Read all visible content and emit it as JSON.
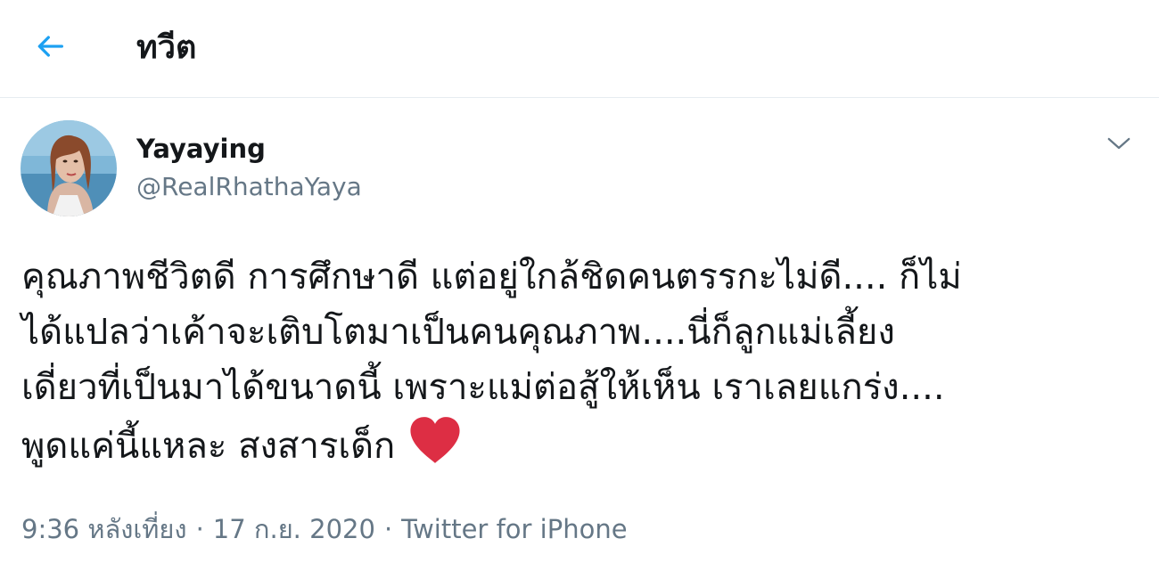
{
  "header": {
    "back_icon": "arrow-left-icon",
    "title": "ทวีต"
  },
  "tweet": {
    "author": {
      "display_name": "Yayaying",
      "handle": "@RealRhathaYaya"
    },
    "menu_icon": "chevron-down-icon",
    "text_lines": [
      "คุณภาพชีวิตดี การศึกษาดี แต่อยู่ใกล้ชิดคนตรรกะไม่ดี.... ก็ไม่",
      "ได้แปลว่าเค้าจะเติบโตมาเป็นคนคุณภาพ....นี่ก็ลูกแม่เลี้ยง",
      "เดี่ยวที่เป็นมาได้ขนาดนี้ เพราะแม่ต่อสู้ให้เห็น เราเลยแกร่ง....",
      "พูดแค่นี้แหละ สงสารเด็ก"
    ],
    "emoji_icon": "heart-icon",
    "meta": {
      "time": "9:36 หลังเที่ยง",
      "separator": "·",
      "date": "17 ก.ย. 2020",
      "source": "Twitter for iPhone"
    }
  },
  "colors": {
    "accent": "#1da1f2",
    "text_primary": "#14171a",
    "text_secondary": "#657786",
    "heart": "#e0245e",
    "divider": "#e6ecf0"
  }
}
